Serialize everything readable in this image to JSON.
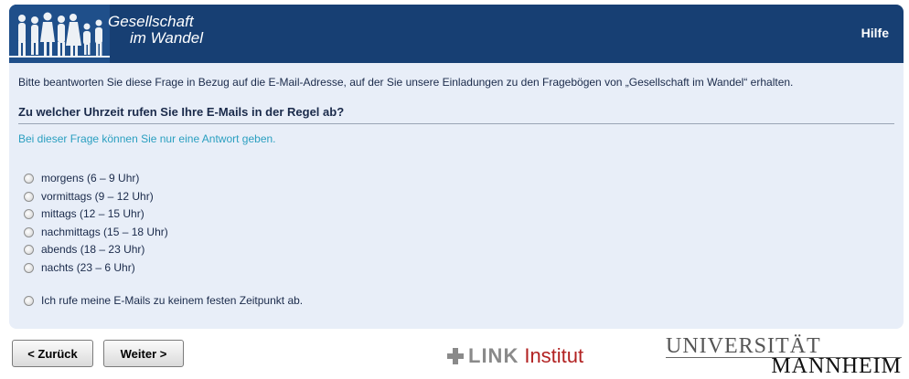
{
  "header": {
    "logo_line1": "Gesellschaft",
    "logo_line2": "im Wandel",
    "help_label": "Hilfe",
    "color": "#173f73"
  },
  "intro_text": "Bitte beantworten Sie diese Frage in Bezug auf die E-Mail-Adresse, auf der Sie unsere Einladungen zu den Fragebögen von „Gesellschaft im Wandel“ erhalten.",
  "question": "Zu welcher Uhrzeit rufen Sie Ihre E-Mails in der Regel ab?",
  "hint": "Bei dieser Frage können Sie nur eine Antwort geben.",
  "options": [
    "morgens (6 – 9 Uhr)",
    "vormittags (9 – 12 Uhr)",
    "mittags (12 – 15 Uhr)",
    "nachmittags (15 – 18 Uhr)",
    "abends (18 – 23 Uhr)",
    "nachts (23 – 6 Uhr)"
  ],
  "extra_option": "Ich rufe meine E-Mails zu keinem festen Zeitpunkt ab.",
  "nav": {
    "back_label": "< Zurück",
    "next_label": "Weiter >"
  },
  "footer": {
    "link_word": "LINK",
    "institut_word": "Institut",
    "uni_line1": "UNIVERSITÄT",
    "uni_line2": "MANNHEIM"
  }
}
